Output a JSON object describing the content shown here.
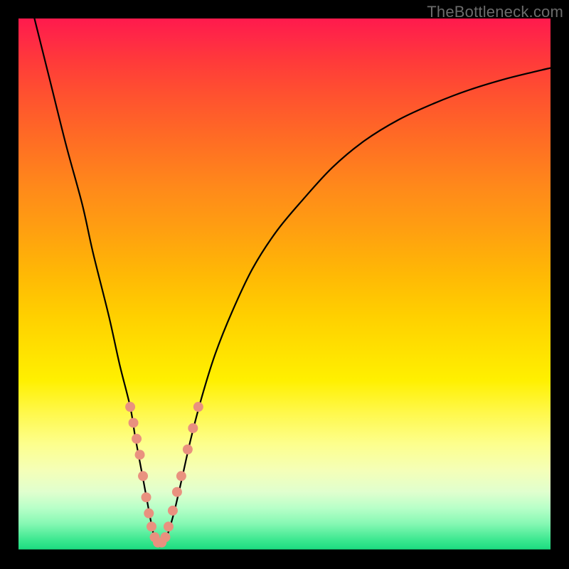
{
  "watermark": "TheBottleneck.com",
  "chart_data": {
    "type": "line",
    "title": "",
    "xlabel": "",
    "ylabel": "",
    "xlim": [
      0,
      100
    ],
    "ylim": [
      0,
      100
    ],
    "grid": false,
    "legend": false,
    "series": [
      {
        "name": "bottleneck-curve",
        "x": [
          3,
          6,
          9,
          12,
          14,
          17,
          19,
          21,
          22,
          23.5,
          24.6,
          25.4,
          26.2,
          27.0,
          28.0,
          29.2,
          30.6,
          32.4,
          34.5,
          37.0,
          40.2,
          44.0,
          48.5,
          53.5,
          59.0,
          65.0,
          71.5,
          78.0,
          84.5,
          91.0,
          97.0,
          100.0
        ],
        "y": [
          100,
          88,
          76,
          65,
          56,
          44,
          35,
          27,
          21,
          13,
          7,
          3,
          1,
          1,
          3,
          7,
          13,
          21,
          29,
          37,
          45,
          53,
          60,
          66,
          72,
          77,
          81,
          84,
          86.5,
          88.5,
          90,
          90.7
        ]
      }
    ],
    "markers": {
      "name": "highlight-points",
      "color": "#e9917f",
      "radius": 7,
      "points": [
        {
          "x": 21.0,
          "y": 27
        },
        {
          "x": 21.6,
          "y": 24
        },
        {
          "x": 22.2,
          "y": 21
        },
        {
          "x": 22.8,
          "y": 18
        },
        {
          "x": 23.4,
          "y": 14
        },
        {
          "x": 24.0,
          "y": 10
        },
        {
          "x": 24.5,
          "y": 7
        },
        {
          "x": 25.0,
          "y": 4.5
        },
        {
          "x": 25.6,
          "y": 2.5
        },
        {
          "x": 26.2,
          "y": 1.5
        },
        {
          "x": 26.9,
          "y": 1.5
        },
        {
          "x": 27.6,
          "y": 2.5
        },
        {
          "x": 28.2,
          "y": 4.5
        },
        {
          "x": 29.0,
          "y": 7.5
        },
        {
          "x": 29.8,
          "y": 11
        },
        {
          "x": 30.6,
          "y": 14
        },
        {
          "x": 31.8,
          "y": 19
        },
        {
          "x": 32.8,
          "y": 23
        },
        {
          "x": 33.8,
          "y": 27
        }
      ]
    },
    "colors": {
      "gradient_top": "#ff1a4d",
      "gradient_mid": "#ffd000",
      "gradient_bottom": "#18da7e",
      "curve": "#000000",
      "marker": "#e9917f"
    }
  }
}
